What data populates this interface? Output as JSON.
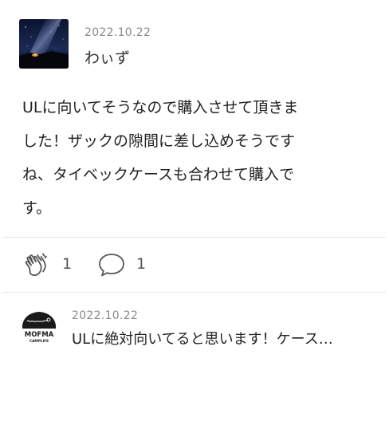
{
  "review": {
    "date": "2022.10.22",
    "author": "わぃず",
    "body": "ULに向いてそうなので購入させて頂きました！ザックの隙間に差し込めそうですね、タイベックケースも合わせて購入です。",
    "body_lines": [
      "ULに向いてそうなので購入させて頂きま",
      "した！ザックの隙間に差し込めそうです",
      "ね、タイベックケースも合わせて購入で",
      "す。"
    ]
  },
  "reactions": {
    "clap_icon": "clap-icon",
    "clap_count": "1",
    "comment_icon": "comment-icon",
    "comment_count": "1"
  },
  "reply": {
    "date": "2022.10.22",
    "text": "ULに絶対向いてると思います！ケース…",
    "avatar_logo_text": "MOFMA",
    "avatar_logo_subtext": "CAMPLIFE"
  },
  "colors": {
    "text_primary": "#222222",
    "text_secondary": "#8a8a8a",
    "divider": "#e6e6e6",
    "icon_stroke": "#555555"
  }
}
